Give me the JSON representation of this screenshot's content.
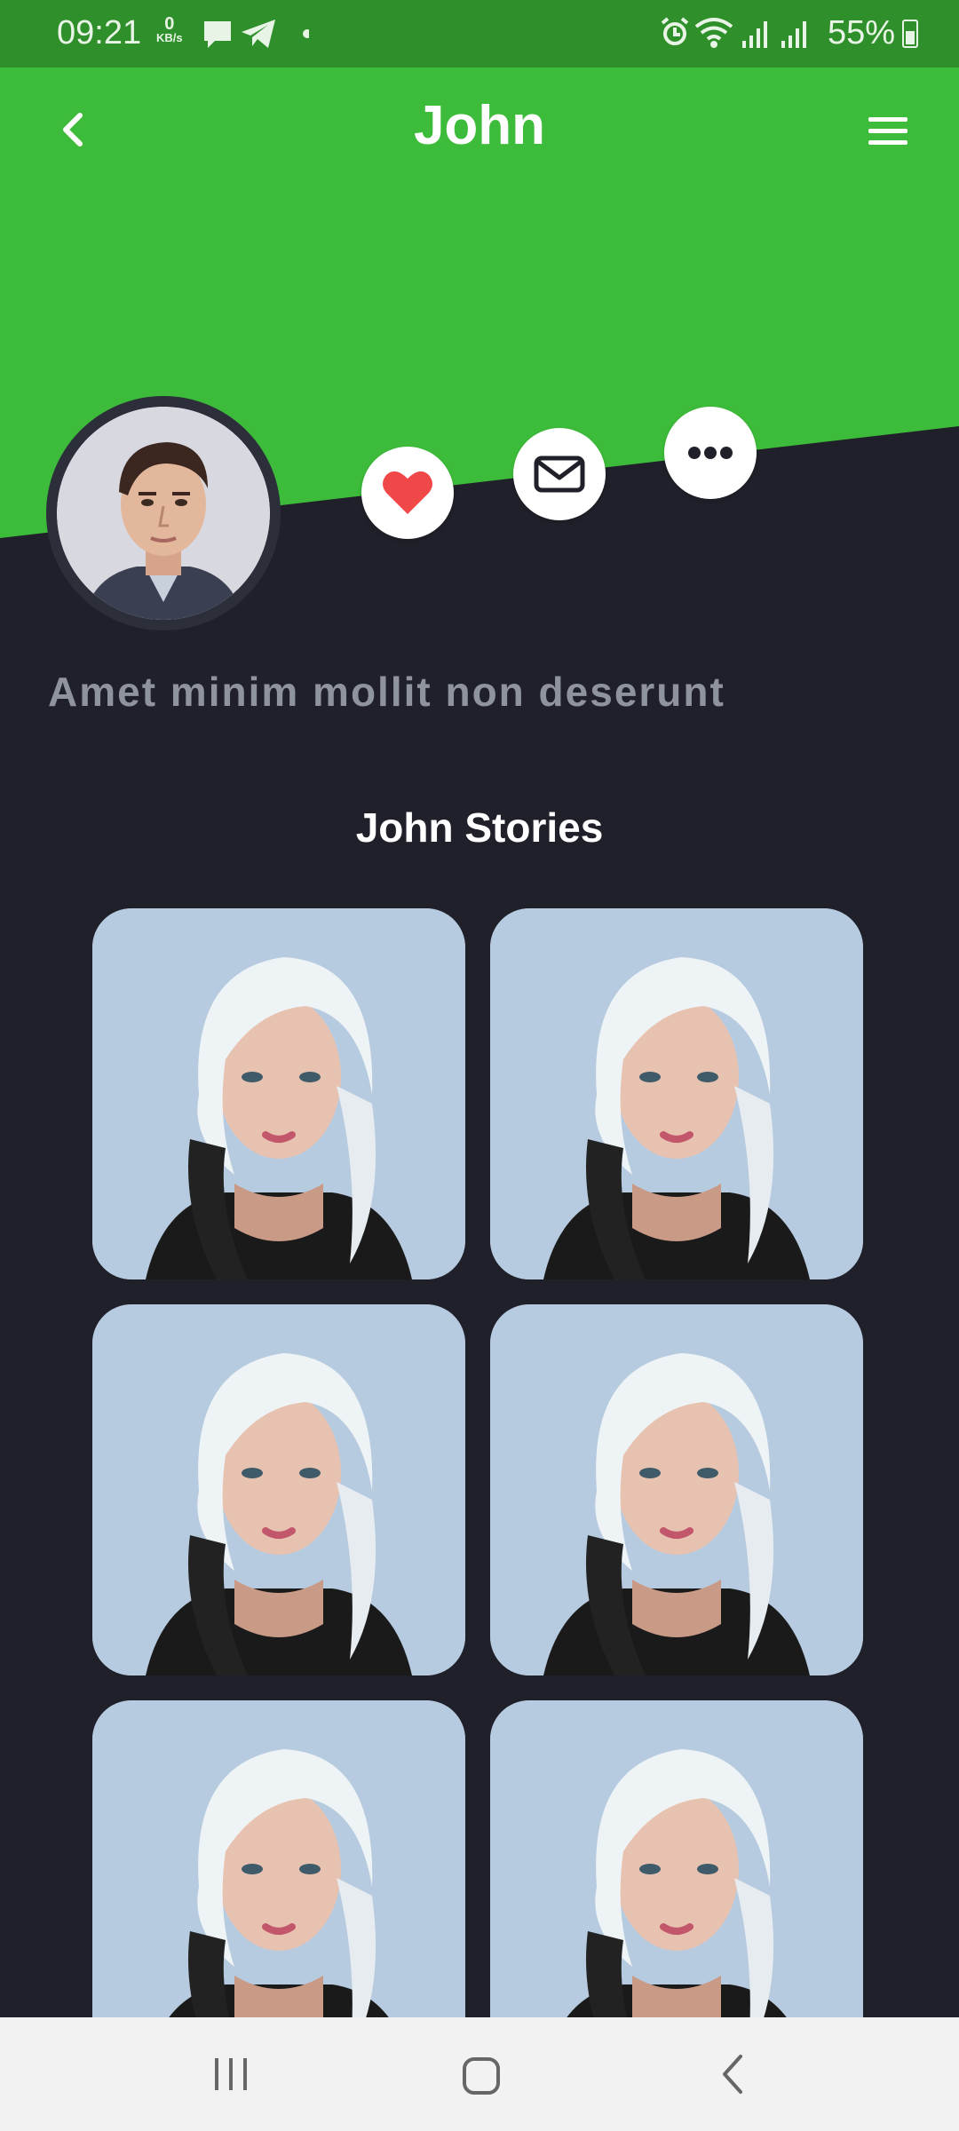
{
  "status_bar": {
    "time": "09:21",
    "net_speed_value": "0",
    "net_speed_unit": "KB/s",
    "battery": "55%"
  },
  "header": {
    "title": "John"
  },
  "profile": {
    "bio": "Amet minim mollit non deserunt",
    "stories_title": "John Stories"
  },
  "stories": [
    {
      "id": 1
    },
    {
      "id": 2
    },
    {
      "id": 3
    },
    {
      "id": 4
    },
    {
      "id": 5
    },
    {
      "id": 6
    }
  ],
  "colors": {
    "accent": "#3DBB3A",
    "status_bar": "#2F8F2A",
    "background": "#1F2029",
    "heart": "#F04848"
  }
}
